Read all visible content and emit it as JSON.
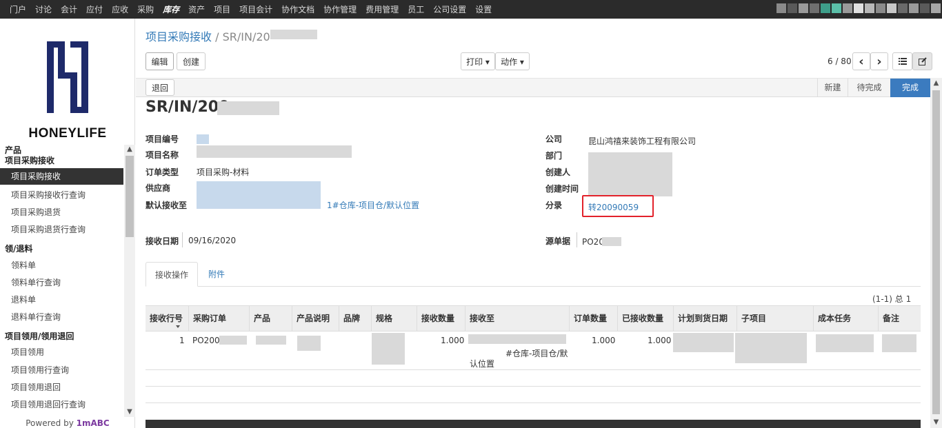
{
  "topnav": [
    "门户",
    "讨论",
    "会计",
    "应付",
    "应收",
    "采购",
    "库存",
    "资产",
    "项目",
    "项目会计",
    "协作文档",
    "协作管理",
    "费用管理",
    "员工",
    "公司设置",
    "设置"
  ],
  "topnav_active": "库存",
  "logo_text": "HONEYLIFE",
  "sidebar": {
    "section_title": "产品",
    "groups": [
      {
        "title": "项目采购接收",
        "items": [
          "项目采购接收",
          "项目采购接收行查询",
          "项目采购退货",
          "项目采购退货行查询"
        ]
      },
      {
        "title": "领/退料",
        "items": [
          "领料单",
          "领料单行查询",
          "退料单",
          "退料单行查询"
        ]
      },
      {
        "title": "项目领用/领用退回",
        "items": [
          "项目领用",
          "项目领用行查询",
          "项目领用退回",
          "项目领用退回行查询"
        ]
      }
    ],
    "active_item": "项目采购接收",
    "powered_prefix": "Powered by",
    "powered_brand": "1mABC"
  },
  "breadcrumb": {
    "parent": "项目采购接收",
    "sep": "/",
    "current": "SR/IN/20"
  },
  "toolbar": {
    "edit": "编辑",
    "create": "创建",
    "print": "打印 ▾",
    "action": "动作 ▾",
    "pager": "6 / 80",
    "prev": "‹",
    "next": "›"
  },
  "statusbar": {
    "back": "退回",
    "stages": [
      "新建",
      "待完成",
      "完成"
    ],
    "current_stage": "完成"
  },
  "record": {
    "title": "SR/IN/200",
    "left_labels": [
      "项目编号",
      "项目名称",
      "订单类型",
      "供应商",
      "默认接收至"
    ],
    "order_type": "项目采购-材料",
    "default_dest_suffix": "1#仓库-项目仓/默认位置",
    "right_labels": [
      "公司",
      "部门",
      "创建人",
      "创建时间",
      "分录"
    ],
    "company": "昆山鸿禧来装饰工程有限公司",
    "journal_entry": "转20090059",
    "receive_date_label": "接收日期",
    "receive_date": "09/16/2020",
    "source_label": "源单据",
    "source": "PO20"
  },
  "tabs": [
    "接收操作",
    "附件"
  ],
  "table": {
    "count": "(1-1) 总 1",
    "headers": [
      "接收行号",
      "采购订单",
      "产品",
      "产品说明",
      "品牌",
      "规格",
      "接收数量",
      "接收至",
      "订单数量",
      "已接收数量",
      "计划到货日期",
      "子项目",
      "成本任务",
      "备注"
    ],
    "rows": [
      {
        "line": "1",
        "po": "PO200",
        "qty": "1.000",
        "dest_line1": "#仓库-项目仓/默",
        "dest_line2": "认位置",
        "order_qty": "1.000",
        "received_qty": "1.000"
      }
    ]
  },
  "colors": {
    "accent": "#337ab7",
    "highlight": "#e2212a",
    "stage_done": "#3b7bbf",
    "topbar": "#2b2b2b"
  }
}
